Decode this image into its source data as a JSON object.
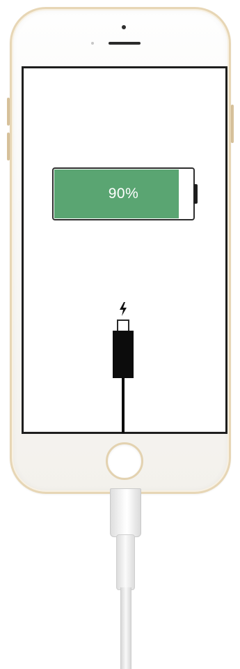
{
  "battery": {
    "level_label": "90%",
    "level_fraction": 0.9,
    "fill_color": "#5aa572"
  },
  "charging": {
    "icon": "lightning-bolt-icon",
    "plug_icon": "lightning-plug-icon"
  },
  "device": {
    "frame_color": "#e7d6b5",
    "home_button_icon": "home-button"
  }
}
